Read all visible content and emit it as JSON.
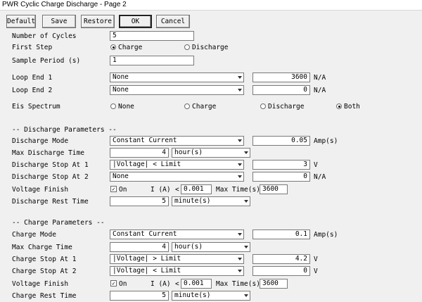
{
  "window": {
    "title": "PWR Cyclic Charge Discharge - Page 2"
  },
  "toolbar": {
    "default_label": "Default",
    "save_label": "Save",
    "restore_label": "Restore",
    "ok_label": "OK",
    "cancel_label": "Cancel"
  },
  "general": {
    "num_cycles_label": "Number of Cycles",
    "num_cycles_value": "5",
    "first_step_label": "First Step",
    "first_step_charge": "Charge",
    "first_step_discharge": "Discharge",
    "first_step_selected": "Charge",
    "sample_period_label": "Sample Period (s)",
    "sample_period_value": "1",
    "loop_end1_label": "Loop End 1",
    "loop_end1_select": "None",
    "loop_end1_value": "3600",
    "loop_end1_unit": "N/A",
    "loop_end2_label": "Loop End 2",
    "loop_end2_select": "None",
    "loop_end2_value": "0",
    "loop_end2_unit": "N/A",
    "eis_label": "Eis Spectrum",
    "eis_none": "None",
    "eis_charge": "Charge",
    "eis_discharge": "Discharge",
    "eis_both": "Both",
    "eis_selected": "Both"
  },
  "discharge": {
    "header": "-- Discharge Parameters --",
    "mode_label": "Discharge Mode",
    "mode_select": "Constant Current",
    "mode_value": "0.05",
    "mode_unit": "Amp(s)",
    "max_time_label": "Max Discharge Time",
    "max_time_value": "4",
    "max_time_unit": "hour(s)",
    "stop1_label": "Discharge Stop At 1",
    "stop1_select": "|Voltage| < Limit",
    "stop1_value": "3",
    "stop1_unit": "V",
    "stop2_label": "Discharge Stop At 2",
    "stop2_select": "None",
    "stop2_value": "0",
    "stop2_unit": "N/A",
    "vf_label": "Voltage Finish",
    "vf_on": "On",
    "vf_i_label": "I (A)",
    "vf_lt": "<",
    "vf_i_value": "0.001",
    "vf_max_label": "Max Time(s)",
    "vf_max_value": "3600",
    "rest_label": "Discharge Rest Time",
    "rest_value": "5",
    "rest_unit": "minute(s)"
  },
  "charge": {
    "header": "-- Charge Parameters --",
    "mode_label": "Charge Mode",
    "mode_select": "Constant Current",
    "mode_value": "0.1",
    "mode_unit": "Amp(s)",
    "max_time_label": "Max Charge Time",
    "max_time_value": "4",
    "max_time_unit": "hour(s)",
    "stop1_label": "Charge Stop At 1",
    "stop1_select": "|Voltage| > Limit",
    "stop1_value": "4.2",
    "stop1_unit": "V",
    "stop2_label": "Charge Stop At 2",
    "stop2_select": "|Voltage| < Limit",
    "stop2_value": "0",
    "stop2_unit": "V",
    "vf_label": "Voltage Finish",
    "vf_on": "On",
    "vf_i_label": "I (A)",
    "vf_lt": "<",
    "vf_i_value": "0.001",
    "vf_max_label": "Max Time(s)",
    "vf_max_value": "3600",
    "rest_label": "Charge Rest Time",
    "rest_value": "5",
    "rest_unit": "minute(s)"
  }
}
